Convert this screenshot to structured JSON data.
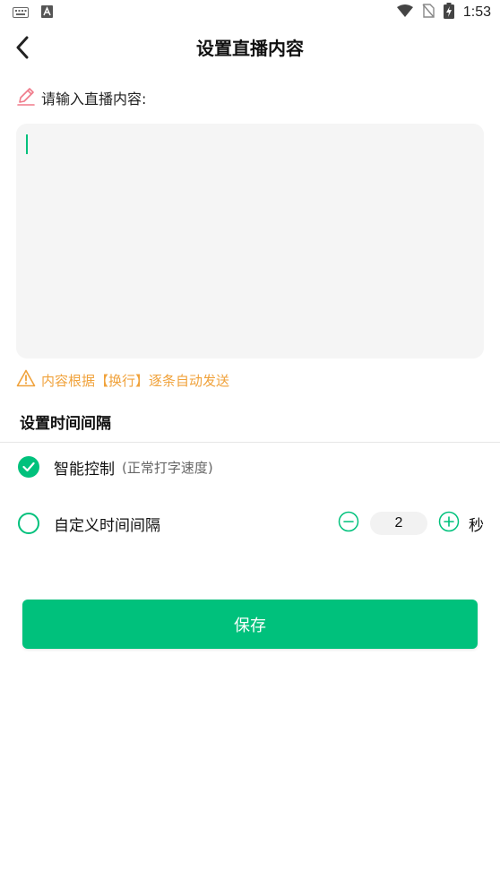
{
  "status_bar": {
    "time": "1:53",
    "icons": [
      "keyboard-icon",
      "a-badge-icon",
      "wifi-icon",
      "no-sim-icon",
      "battery-charging-icon"
    ]
  },
  "header": {
    "title": "设置直播内容",
    "back_icon": "chevron-left-icon"
  },
  "content_input": {
    "label": "请输入直播内容:",
    "label_icon": "pencil-icon",
    "value": "",
    "notice": "内容根据【换行】逐条自动发送",
    "notice_icon": "warning-icon"
  },
  "interval": {
    "section_title": "设置时间间隔",
    "options": [
      {
        "label": "智能控制",
        "sub": "(正常打字速度)",
        "checked": true
      },
      {
        "label": "自定义时间间隔",
        "checked": false
      }
    ],
    "custom_value": "2",
    "unit": "秒"
  },
  "actions": {
    "save_label": "保存"
  },
  "colors": {
    "accent": "#00c17c",
    "warning": "#f0a23b",
    "pencil": "#f07a8a"
  }
}
